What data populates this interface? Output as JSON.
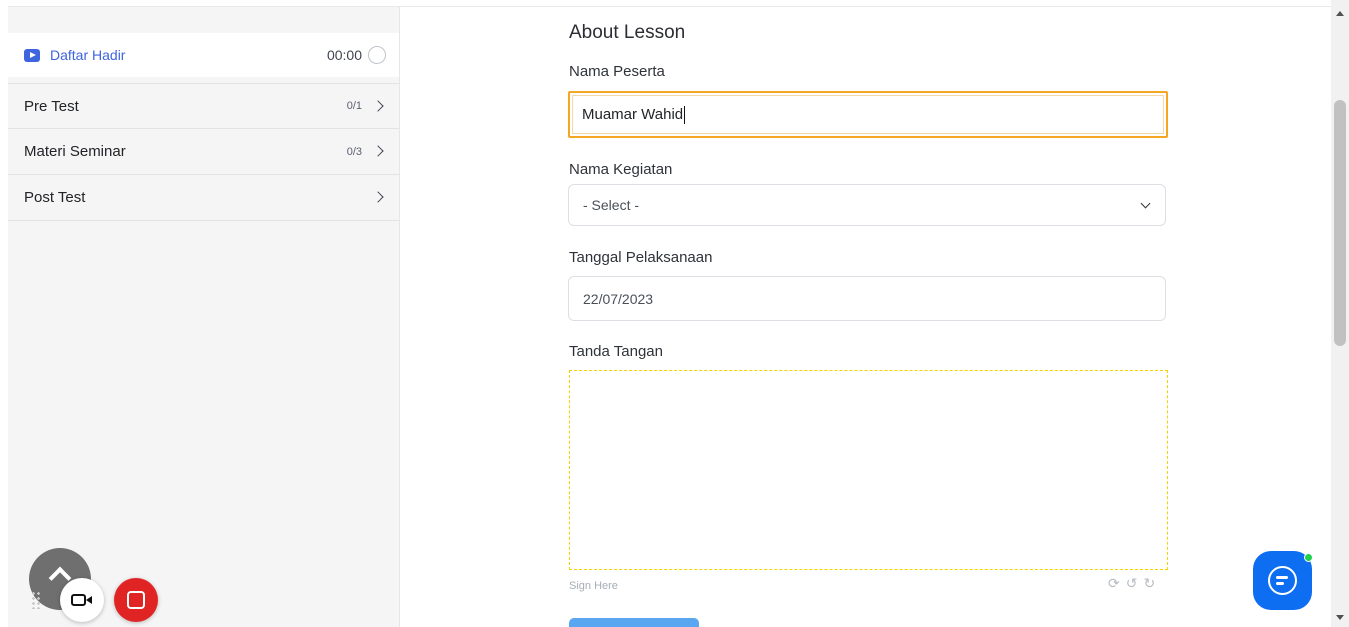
{
  "sidebar": {
    "active_item": {
      "label": "Daftar Hadir",
      "time": "00:00",
      "icon": "play-icon"
    },
    "topics": [
      {
        "label": "Pre Test",
        "count": "0/1"
      },
      {
        "label": "Materi Seminar",
        "count": "0/3"
      },
      {
        "label": "Post Test",
        "count": ""
      }
    ]
  },
  "form": {
    "title": "About Lesson",
    "nama_peserta": {
      "label": "Nama Peserta",
      "value": "Muamar Wahid"
    },
    "nama_kegiatan": {
      "label": "Nama Kegiatan",
      "selected": "- Select -"
    },
    "tanggal": {
      "label": "Tanggal Pelaksanaan",
      "value": "22/07/2023"
    },
    "tanda_tangan": {
      "label": "Tanda Tangan",
      "caption": "Sign Here"
    },
    "pad_tools": [
      "⟳",
      "↺",
      "↻"
    ]
  },
  "colors": {
    "accent": "#3e64de",
    "focus_border": "#f5a623",
    "signature_border": "#f5d300",
    "chat": "#0d6ef2",
    "record": "#e02424"
  }
}
